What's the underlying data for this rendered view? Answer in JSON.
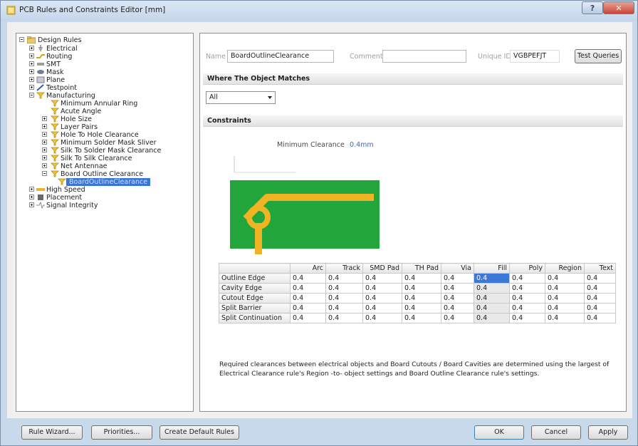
{
  "window": {
    "title": "PCB Rules and Constraints Editor [mm]",
    "help": "?",
    "close": "✕"
  },
  "tree": {
    "root": "Design Rules",
    "items": [
      {
        "label": "Electrical",
        "icon": "electrical-icon"
      },
      {
        "label": "Routing",
        "icon": "routing-icon"
      },
      {
        "label": "SMT",
        "icon": "smt-icon"
      },
      {
        "label": "Mask",
        "icon": "mask-icon"
      },
      {
        "label": "Plane",
        "icon": "plane-icon"
      },
      {
        "label": "Testpoint",
        "icon": "testpoint-icon"
      },
      {
        "label": "Manufacturing",
        "icon": "rule-icon"
      },
      {
        "label": "Minimum Annular Ring",
        "icon": "rule-icon"
      },
      {
        "label": "Acute Angle",
        "icon": "rule-icon"
      },
      {
        "label": "Hole Size",
        "icon": "rule-icon"
      },
      {
        "label": "Layer Pairs",
        "icon": "rule-icon"
      },
      {
        "label": "Hole To Hole Clearance",
        "icon": "rule-icon"
      },
      {
        "label": "Minimum Solder Mask Sliver",
        "icon": "rule-icon"
      },
      {
        "label": "Silk To Solder Mask Clearance",
        "icon": "rule-icon"
      },
      {
        "label": "Silk To Silk Clearance",
        "icon": "rule-icon"
      },
      {
        "label": "Net Antennae",
        "icon": "rule-icon"
      },
      {
        "label": "Board Outline Clearance",
        "icon": "rule-icon"
      },
      {
        "label": "BoardOutlineClearance",
        "icon": "rule-icon",
        "selected": true
      },
      {
        "label": "High Speed",
        "icon": "high-speed-icon"
      },
      {
        "label": "Placement",
        "icon": "placement-icon"
      },
      {
        "label": "Signal Integrity",
        "icon": "signal-integrity-icon"
      }
    ]
  },
  "rule": {
    "name_label": "Name",
    "name_value": "BoardOutlineClearance",
    "comment_label": "Comment",
    "comment_value": "",
    "uid_label": "Unique ID",
    "uid_value": "VGBPEFJT",
    "test_queries": "Test Queries"
  },
  "where": {
    "header": "Where The Object Matches",
    "selected": "All"
  },
  "constraints": {
    "header": "Constraints",
    "min_clearance_label": "Minimum Clearance",
    "min_clearance_value": "0.4mm",
    "columns": [
      "",
      "Arc",
      "Track",
      "SMD Pad",
      "TH Pad",
      "Via",
      "Fill",
      "Poly",
      "Region",
      "Text"
    ],
    "rows": [
      {
        "name": "Outline Edge",
        "values": [
          "0.4",
          "0.4",
          "0.4",
          "0.4",
          "0.4",
          "0.4",
          "0.4",
          "0.4",
          "0.4"
        ]
      },
      {
        "name": "Cavity Edge",
        "values": [
          "0.4",
          "0.4",
          "0.4",
          "0.4",
          "0.4",
          "0.4",
          "0.4",
          "0.4",
          "0.4"
        ]
      },
      {
        "name": "Cutout Edge",
        "values": [
          "0.4",
          "0.4",
          "0.4",
          "0.4",
          "0.4",
          "0.4",
          "0.4",
          "0.4",
          "0.4"
        ]
      },
      {
        "name": "Split Barrier",
        "values": [
          "0.4",
          "0.4",
          "0.4",
          "0.4",
          "0.4",
          "0.4",
          "0.4",
          "0.4",
          "0.4"
        ]
      },
      {
        "name": "Split Continuation",
        "values": [
          "0.4",
          "0.4",
          "0.4",
          "0.4",
          "0.4",
          "0.4",
          "0.4",
          "0.4",
          "0.4"
        ]
      }
    ],
    "note": "Required clearances between electrical objects and Board Cutouts / Board Cavities are determined using the largest of Electrical Clearance rule's Region -to- object settings and Board Outline Clearance rule's settings."
  },
  "buttons": {
    "rule_wizard": "Rule Wizard...",
    "priorities": "Priorities...",
    "create_default": "Create Default Rules",
    "ok": "OK",
    "cancel": "Cancel",
    "apply": "Apply"
  },
  "colors": {
    "board": "#22a63c",
    "track": "#f0b323",
    "selection": "#3875d7"
  }
}
